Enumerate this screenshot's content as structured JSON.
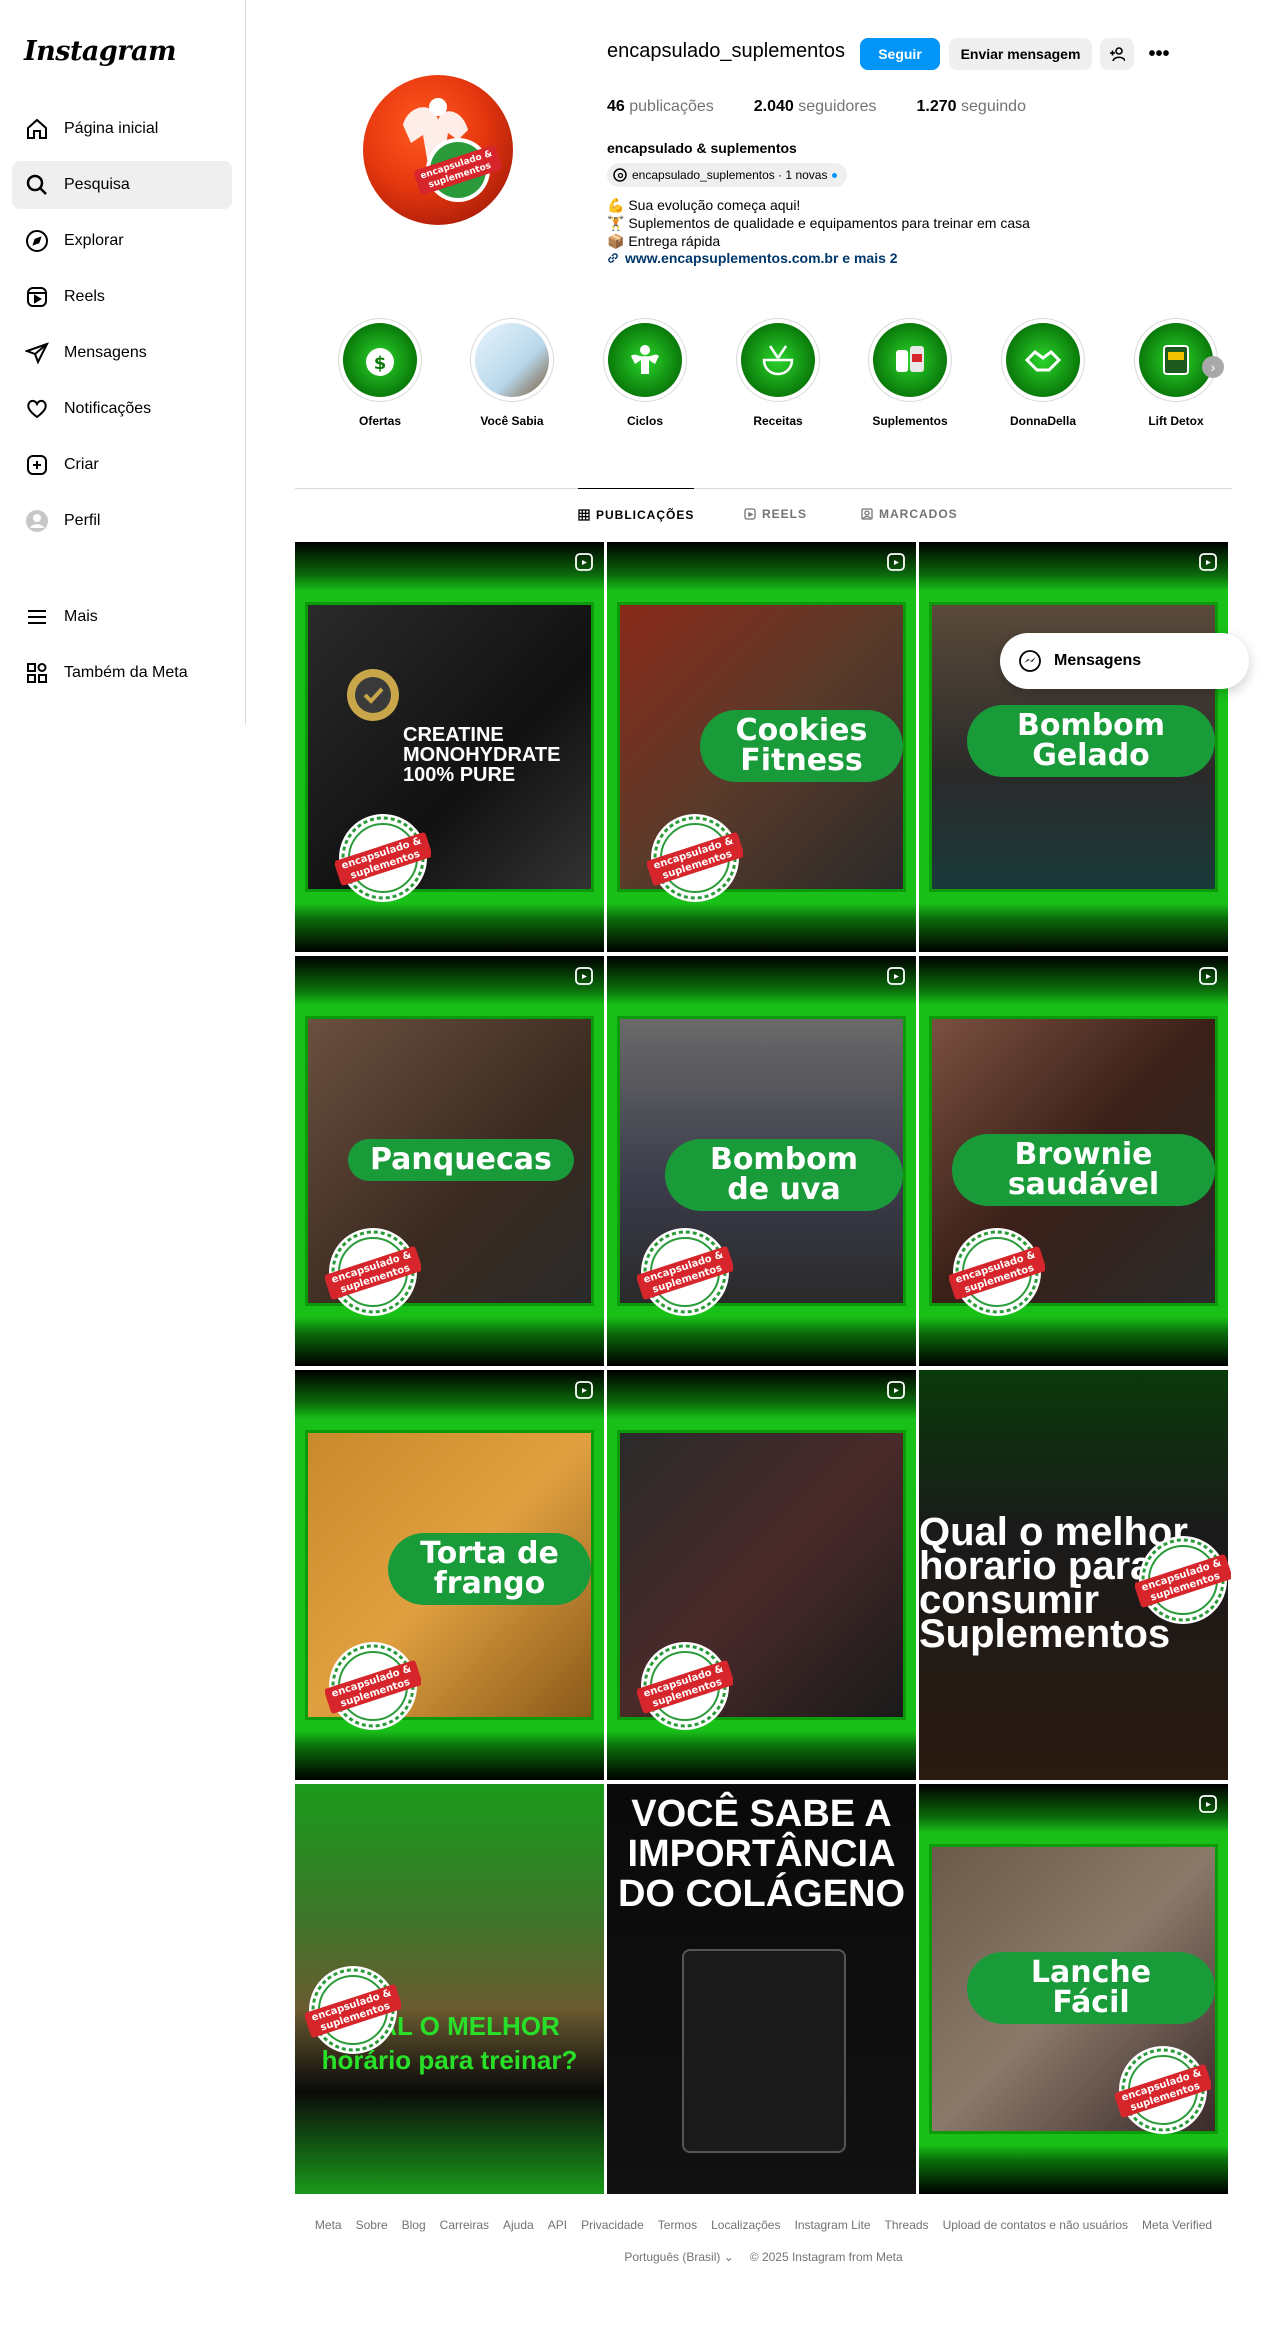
{
  "sidebar": {
    "logo": "Instagram",
    "items": [
      {
        "label": "Página inicial",
        "icon": "home-icon"
      },
      {
        "label": "Pesquisa",
        "icon": "search-icon"
      },
      {
        "label": "Explorar",
        "icon": "compass-icon"
      },
      {
        "label": "Reels",
        "icon": "reels-icon"
      },
      {
        "label": "Mensagens",
        "icon": "messages-icon"
      },
      {
        "label": "Notificações",
        "icon": "heart-icon"
      },
      {
        "label": "Criar",
        "icon": "create-icon"
      },
      {
        "label": "Perfil",
        "icon": "profile-icon"
      },
      {
        "label": "Mais",
        "icon": "menu-icon"
      },
      {
        "label": "Também da Meta",
        "icon": "meta-apps-icon"
      }
    ]
  },
  "profile": {
    "username": "encapsulado_suplementos",
    "follow_label": "Seguir",
    "message_label": "Enviar mensagem",
    "more_label": "•••",
    "posts_count": "46",
    "posts_label": "publicações",
    "followers_count": "2.040",
    "followers_label": "seguidores",
    "following_count": "1.270",
    "following_label": "seguindo",
    "full_name": "encapsulado & suplementos",
    "threads_label": "encapsulado_suplementos · 1 novas",
    "bio_lines": [
      "💪 Sua evolução começa aqui!",
      "🏋️ Suplementos de qualidade e equipamentos para treinar em casa",
      "📦 Entrega rápida"
    ],
    "link": "www.encapsuplementos.com.br e mais 2"
  },
  "highlights": [
    "Ofertas",
    "Você Sabia",
    "Ciclos",
    "Receitas",
    "Suplementos",
    "DonnaDella",
    "Lift Detox"
  ],
  "tabs": [
    {
      "label": "PUBLICAÇÕES",
      "active": true
    },
    {
      "label": "REELS",
      "active": false
    },
    {
      "label": "MARCADOS",
      "active": false
    }
  ],
  "posts": [
    {
      "caption": "CREATINE MONOHYDRATE 100% PURE",
      "reel": true
    },
    {
      "caption": "Cookies Fitness",
      "reel": true
    },
    {
      "caption": "Bombom Gelado",
      "reel": true
    },
    {
      "caption": "Panquecas",
      "reel": true
    },
    {
      "caption": "Bombom de uva",
      "reel": true
    },
    {
      "caption": "Brownie saudável",
      "reel": true
    },
    {
      "caption": "Torta de frango",
      "reel": true
    },
    {
      "caption": "",
      "reel": true
    },
    {
      "caption": "Qual o melhor horario para consumir Suplementos",
      "reel": false
    },
    {
      "caption": "QUAL O MELHOR horário para treinar?",
      "reel": false
    },
    {
      "caption": "VOCÊ SABE A IMPORTÂNCIA DO COLÁGENO",
      "reel": false
    },
    {
      "caption": "Lanche Fácil",
      "reel": true
    }
  ],
  "seal_text": "encapsulado & suplementos",
  "messages_popup": "Mensagens",
  "footer": {
    "links": [
      "Meta",
      "Sobre",
      "Blog",
      "Carreiras",
      "Ajuda",
      "API",
      "Privacidade",
      "Termos",
      "Localizações",
      "Instagram Lite",
      "Threads",
      "Upload de contatos e não usuários",
      "Meta Verified"
    ],
    "language": "Português (Brasil)",
    "copyright": "© 2025 Instagram from Meta"
  },
  "colors": {
    "accent": "#0095f6",
    "brand_green": "#18c018",
    "seal_red": "#d7262b"
  }
}
